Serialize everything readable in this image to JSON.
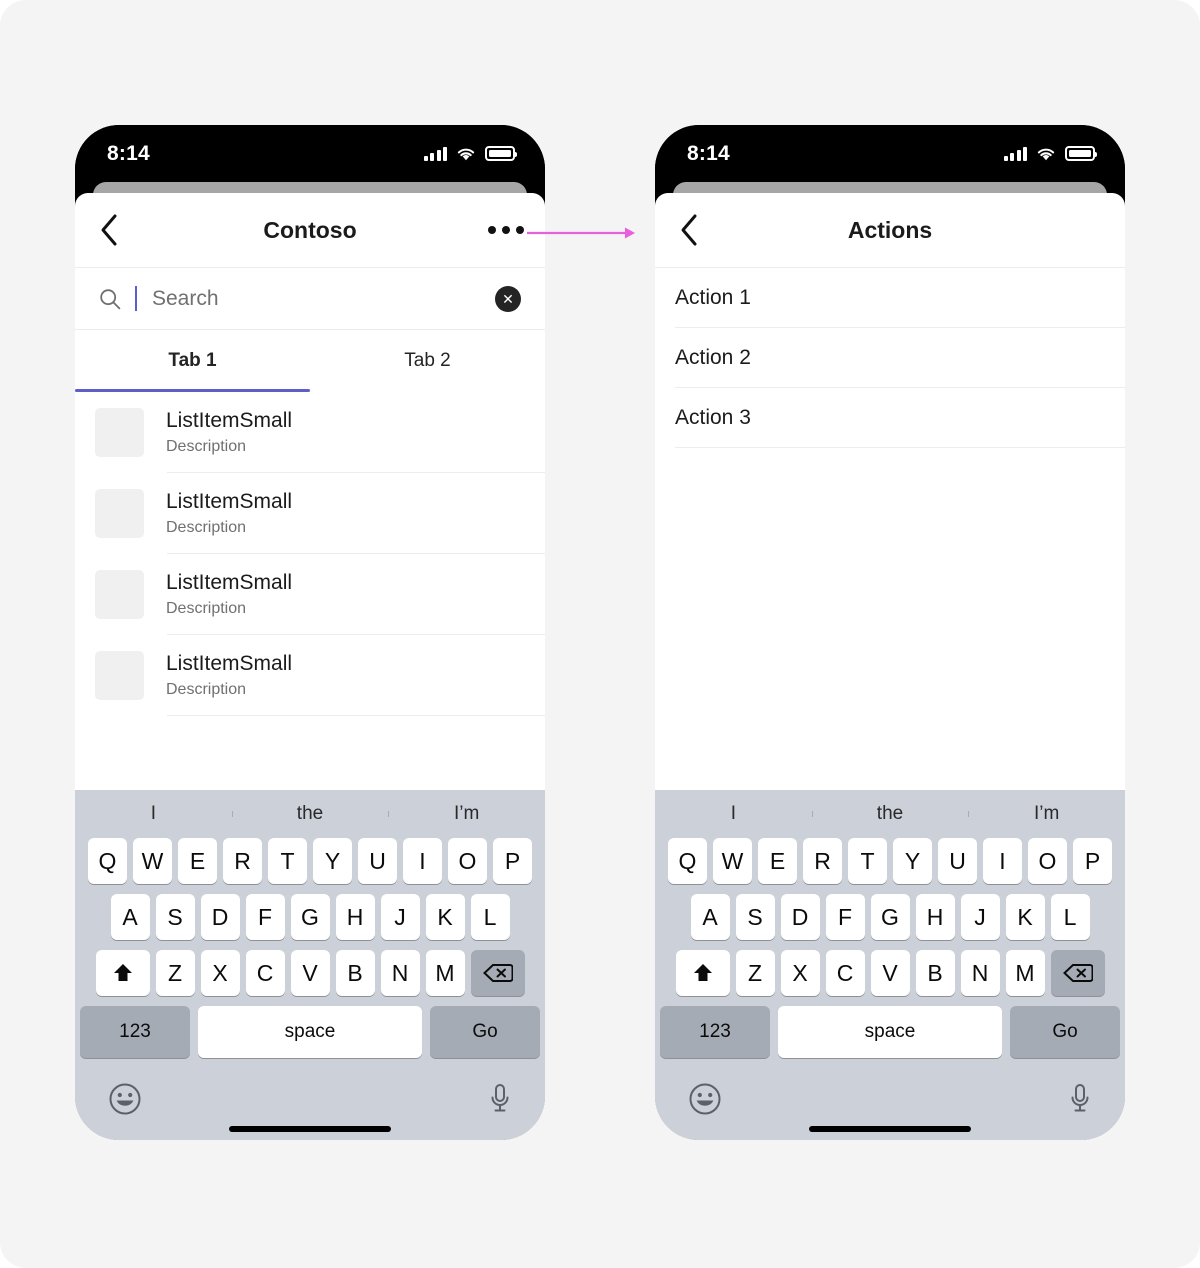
{
  "canvas": {
    "background": "#f4f4f4"
  },
  "accent": {
    "brand": "#5b5fc7",
    "arrow": "#ea5fdb"
  },
  "status_bar": {
    "time": "8:14",
    "signal_icon": "cellular-bars-icon",
    "wifi_icon": "wifi-icon",
    "battery_icon": "battery-full-icon"
  },
  "left_phone": {
    "nav": {
      "back_icon": "chevron-left-icon",
      "title": "Contoso",
      "more_icon": "more-horizontal-icon"
    },
    "search": {
      "icon": "search-icon",
      "placeholder": "Search",
      "value": "",
      "clear_icon": "dismiss-circle-icon",
      "clear_glyph": "✕"
    },
    "tabs": [
      {
        "label": "Tab 1",
        "active": true
      },
      {
        "label": "Tab 2",
        "active": false
      }
    ],
    "list_items": [
      {
        "title": "ListItemSmall",
        "description": "Description"
      },
      {
        "title": "ListItemSmall",
        "description": "Description"
      },
      {
        "title": "ListItemSmall",
        "description": "Description"
      },
      {
        "title": "ListItemSmall",
        "description": "Description"
      }
    ]
  },
  "right_phone": {
    "nav": {
      "back_icon": "chevron-left-icon",
      "title": "Actions"
    },
    "actions": [
      {
        "label": "Action 1"
      },
      {
        "label": "Action 2"
      },
      {
        "label": "Action 3"
      }
    ]
  },
  "keyboard": {
    "suggestions": [
      "I",
      "the",
      "I’m"
    ],
    "row1": [
      "Q",
      "W",
      "E",
      "R",
      "T",
      "Y",
      "U",
      "I",
      "O",
      "P"
    ],
    "row2": [
      "A",
      "S",
      "D",
      "F",
      "G",
      "H",
      "J",
      "K",
      "L"
    ],
    "row3": [
      "Z",
      "X",
      "C",
      "V",
      "B",
      "N",
      "M"
    ],
    "shift_icon": "shift-up-icon",
    "backspace_icon": "backspace-icon",
    "numeric_label": "123",
    "space_label": "space",
    "return_label": "Go",
    "emoji_icon": "emoji-smiley-icon",
    "mic_icon": "microphone-icon"
  },
  "connector": {
    "arrow_icon": "arrow-right-icon",
    "color": "#ea5fdb"
  }
}
